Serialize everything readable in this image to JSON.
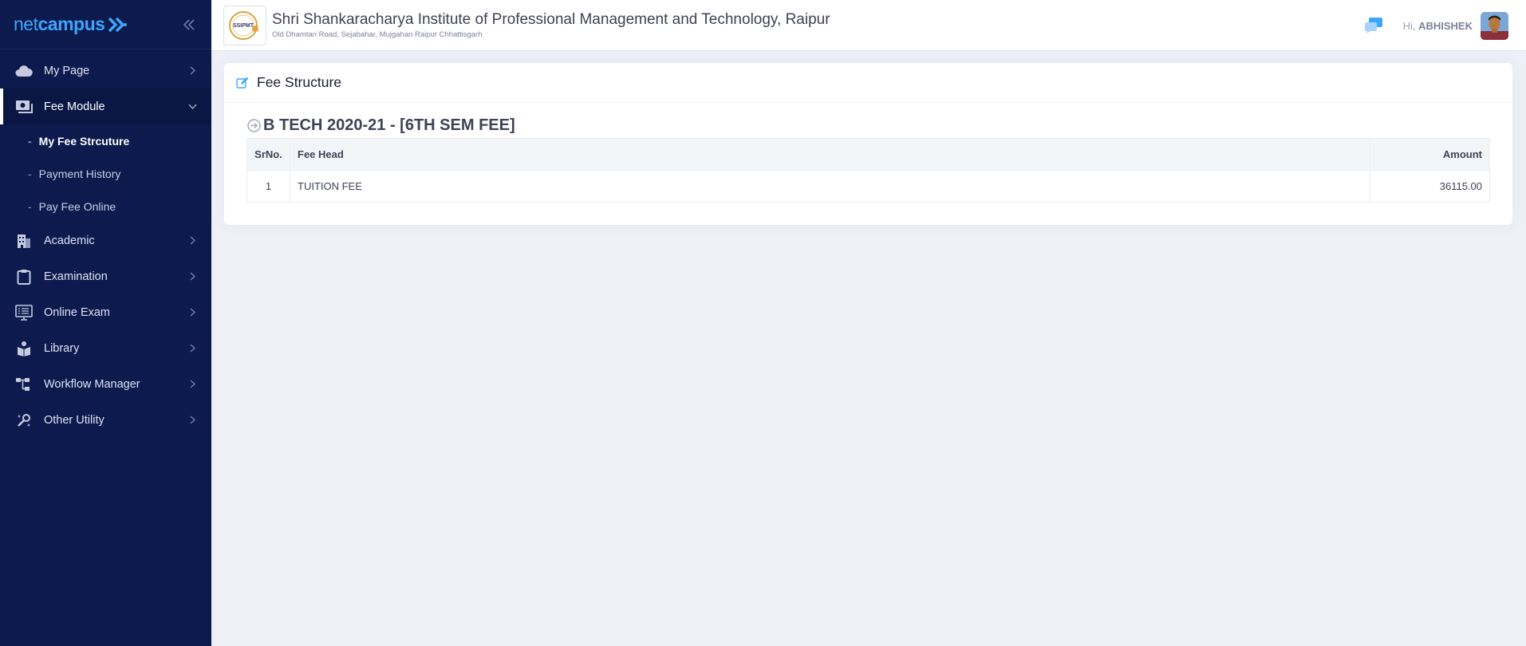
{
  "brand": {
    "net": "net",
    "campus": "campus"
  },
  "sidebar": {
    "items": [
      {
        "label": "My Page",
        "icon": "cloud-icon"
      },
      {
        "label": "Fee Module",
        "icon": "money-icon",
        "expanded": true,
        "children": [
          {
            "label": "My Fee Strcuture",
            "current": true
          },
          {
            "label": "Payment History"
          },
          {
            "label": "Pay Fee Online"
          }
        ]
      },
      {
        "label": "Academic",
        "icon": "building-icon"
      },
      {
        "label": "Examination",
        "icon": "clipboard-icon"
      },
      {
        "label": "Online Exam",
        "icon": "monitor-icon"
      },
      {
        "label": "Library",
        "icon": "book-reader-icon"
      },
      {
        "label": "Workflow Manager",
        "icon": "workflow-icon"
      },
      {
        "label": "Other Utility",
        "icon": "utility-icon"
      }
    ]
  },
  "header": {
    "institute_logo_text": "SSIPMT",
    "institute_name": "Shri Shankaracharya Institute of Professional Management and Technology, Raipur",
    "institute_address": "Old Dhamtari Road, Sejabahar, Mujgahan Raipur Chhattisgarh",
    "greeting": "Hi,",
    "user_name": "ABHISHEK"
  },
  "content": {
    "card_title": "Fee Structure",
    "section_title": "B TECH 2020-21 - [6TH SEM FEE]",
    "table": {
      "headers": {
        "srno": "SrNo.",
        "fee_head": "Fee Head",
        "amount": "Amount"
      },
      "rows": [
        {
          "srno": "1",
          "fee_head": "TUITION FEE",
          "amount": "36115.00"
        }
      ]
    }
  },
  "colors": {
    "sidebar_bg": "#0c1a4d",
    "accent": "#3ea5ff",
    "page_bg": "#eef0f8"
  }
}
